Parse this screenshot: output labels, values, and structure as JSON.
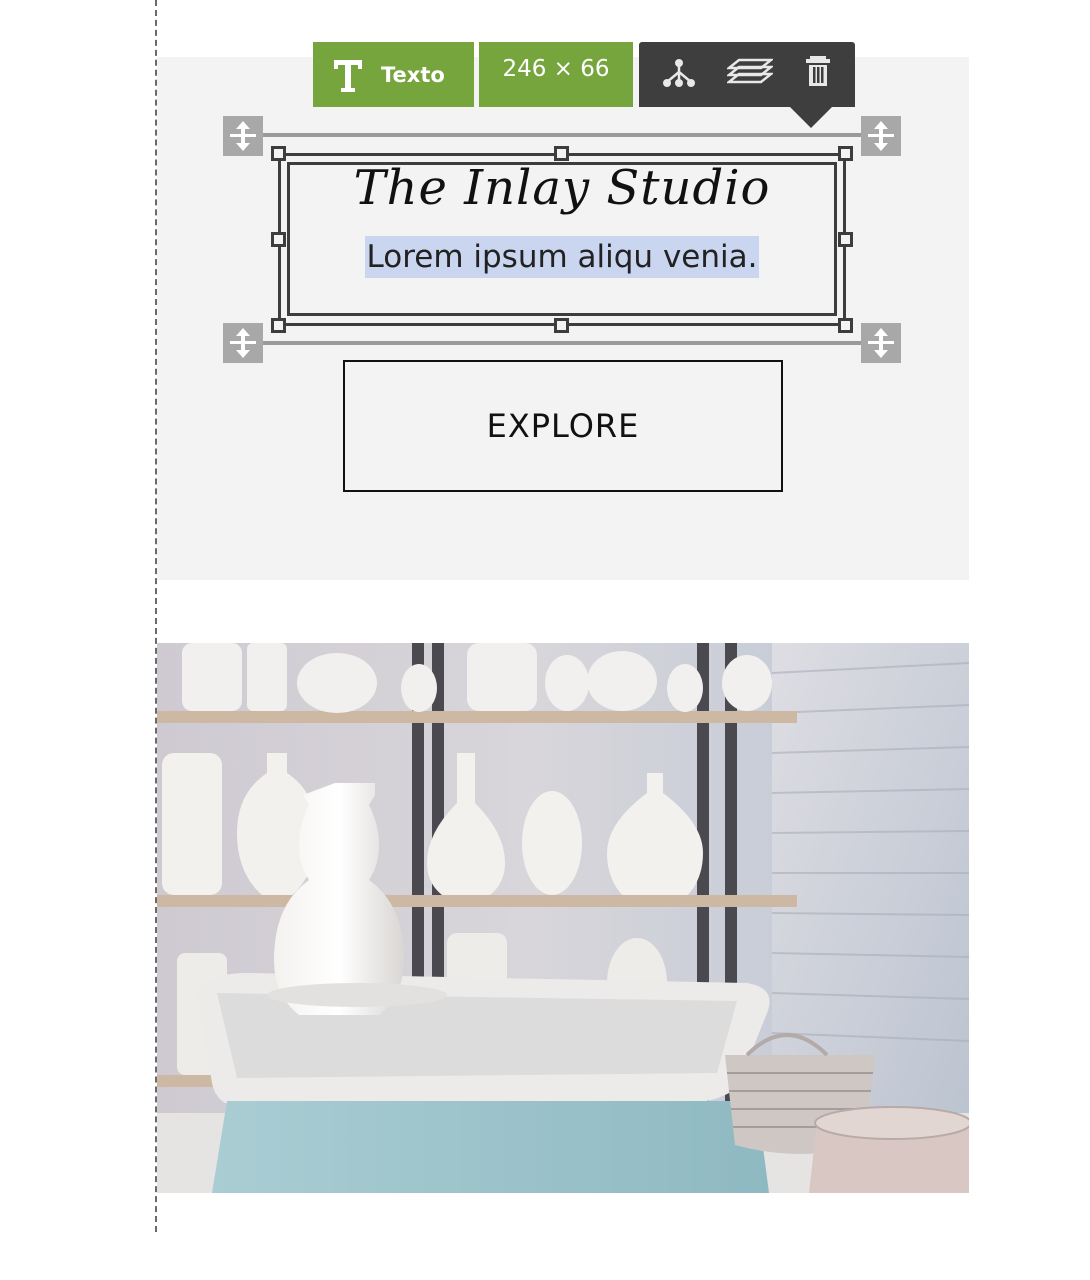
{
  "toolbar": {
    "type_label": "Texto",
    "type_icon": "text-icon",
    "size_label": "246 × 66",
    "actions": [
      "structure-icon",
      "layers-icon",
      "trash-icon"
    ],
    "green": "#76a43d",
    "dark": "#3e3e3e"
  },
  "hero": {
    "title": "The Inlay Studio",
    "subtitle": "Lorem ipsum aliqu venia.",
    "button_label": "EXPLORE",
    "background": "#f3f3f3",
    "selection_highlight": "#cad5f0"
  },
  "image": {
    "subject": "pottery-studio-photo"
  }
}
